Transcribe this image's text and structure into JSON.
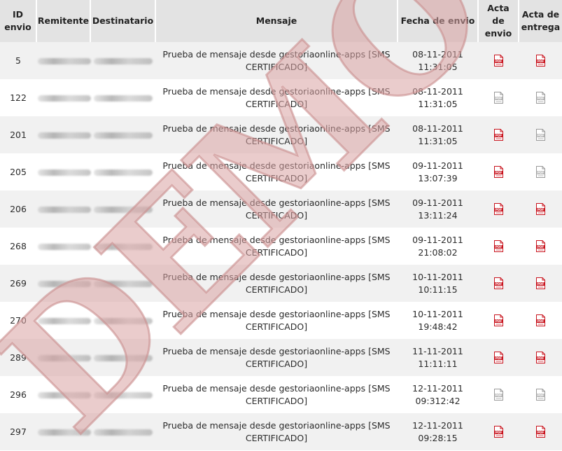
{
  "table": {
    "headers": {
      "id": [
        "ID",
        "envio"
      ],
      "remitente": "Remitente",
      "destinatario": "Destinatario",
      "mensaje": "Mensaje",
      "fecha": "Fecha de envio",
      "acta_envio": [
        "Acta",
        "de",
        "envio"
      ],
      "acta_entrega": [
        "Acta de",
        "entrega"
      ]
    },
    "rows": [
      {
        "id": "5",
        "msg1": "Prueba de mensaje desde gestoriaonline-apps [SMS",
        "msg2": "CERTIFICADO]",
        "date": "08-11-2011",
        "time": "11:31:05",
        "envio_pdf": "active",
        "entrega_pdf": "active"
      },
      {
        "id": "122",
        "msg1": "Prueba de mensaje desde gestoriaonline-apps [SMS",
        "msg2": "CERTIFICADO]",
        "date": "08-11-2011",
        "time": "11:31:05",
        "envio_pdf": "inactive",
        "entrega_pdf": "inactive"
      },
      {
        "id": "201",
        "msg1": "Prueba de mensaje desde gestoriaonline-apps [SMS",
        "msg2": "CERTIFICADO]",
        "date": "08-11-2011",
        "time": "11:31:05",
        "envio_pdf": "active",
        "entrega_pdf": "inactive"
      },
      {
        "id": "205",
        "msg1": "Prueba de mensaje desde gestoriaonline-apps [SMS",
        "msg2": "CERTIFICADO]",
        "date": "09-11-2011",
        "time": "13:07:39",
        "envio_pdf": "active",
        "entrega_pdf": "inactive"
      },
      {
        "id": "206",
        "msg1": "Prueba de mensaje desde gestoriaonline-apps [SMS",
        "msg2": "CERTIFICADO]",
        "date": "09-11-2011",
        "time": "13:11:24",
        "envio_pdf": "active",
        "entrega_pdf": "active"
      },
      {
        "id": "268",
        "msg1": "Prueba de mensaje desde gestoriaonline-apps [SMS",
        "msg2": "CERTIFICADO]",
        "date": "09-11-2011",
        "time": "21:08:02",
        "envio_pdf": "active",
        "entrega_pdf": "active"
      },
      {
        "id": "269",
        "msg1": "Prueba de mensaje desde gestoriaonline-apps [SMS",
        "msg2": "CERTIFICADO]",
        "date": "10-11-2011",
        "time": "10:11:15",
        "envio_pdf": "active",
        "entrega_pdf": "active"
      },
      {
        "id": "270",
        "msg1": "Prueba de mensaje desde gestoriaonline-apps [SMS",
        "msg2": "CERTIFICADO]",
        "date": "10-11-2011",
        "time": "19:48:42",
        "envio_pdf": "active",
        "entrega_pdf": "active"
      },
      {
        "id": "289",
        "msg1": "Prueba de mensaje desde gestoriaonline-apps [SMS",
        "msg2": "CERTIFICADO]",
        "date": "11-11-2011",
        "time": "11:11:11",
        "envio_pdf": "active",
        "entrega_pdf": "active"
      },
      {
        "id": "296",
        "msg1": "Prueba de mensaje desde gestoriaonline-apps [SMS",
        "msg2": "CERTIFICADO]",
        "date": "12-11-2011",
        "time": "09:312:42",
        "envio_pdf": "inactive",
        "entrega_pdf": "inactive"
      },
      {
        "id": "297",
        "msg1": "Prueba de mensaje desde gestoriaonline-apps [SMS",
        "msg2": "CERTIFICADO]",
        "date": "12-11-2011",
        "time": "09:28:15",
        "envio_pdf": "active",
        "entrega_pdf": "active"
      }
    ]
  },
  "icons": {
    "pdf": "pdf-icon",
    "pdf_label": "PDF"
  },
  "watermark": {
    "text": "DEMO",
    "color": "#d9a3a3"
  },
  "colors": {
    "header_bg": "#e3e3e3",
    "row_odd": "#f1f1f1",
    "row_even": "#ffffff",
    "pdf_red": "#c8141e"
  }
}
